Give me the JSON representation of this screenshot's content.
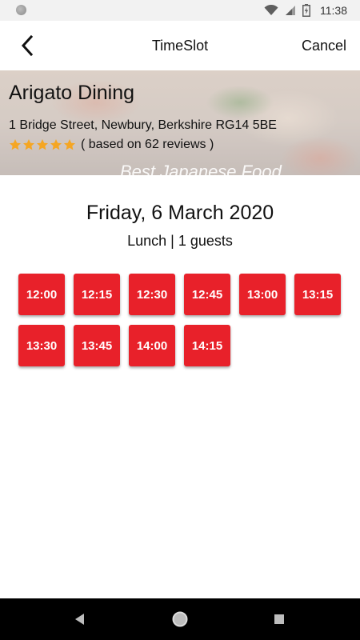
{
  "status_bar": {
    "time": "11:38"
  },
  "header": {
    "title": "TimeSlot",
    "cancel_label": "Cancel"
  },
  "restaurant": {
    "name": "Arigato Dining",
    "address": "1 Bridge Street, Newbury, Berkshire RG14 5BE",
    "rating_stars": 5,
    "reviews_text": "( based on 62 reviews )",
    "banner_watermark": "Best Japanese Food"
  },
  "booking": {
    "date": "Friday, 6 March 2020",
    "meal_summary": "Lunch | 1 guests"
  },
  "time_slots": [
    "12:00",
    "12:15",
    "12:30",
    "12:45",
    "13:00",
    "13:15",
    "13:30",
    "13:45",
    "14:00",
    "14:15"
  ],
  "colors": {
    "accent": "#e8212a",
    "star": "#f5a623"
  },
  "icons": {
    "back": "chevron-left-icon",
    "wifi": "wifi-icon",
    "signal": "signal-icon",
    "battery": "battery-icon",
    "nav_back": "triangle-back-icon",
    "nav_home": "circle-home-icon",
    "nav_recents": "square-recents-icon"
  }
}
